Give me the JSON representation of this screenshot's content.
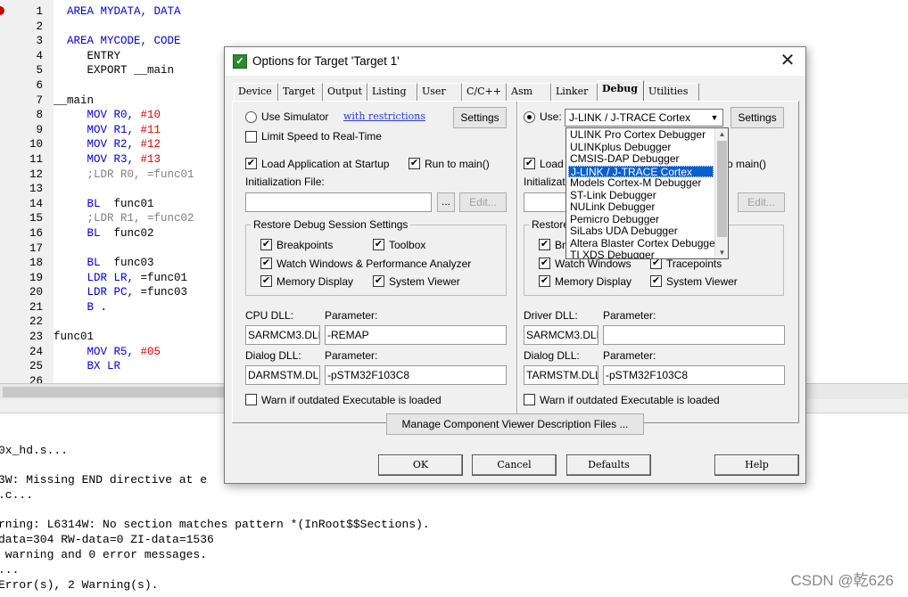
{
  "editor": {
    "lines": [
      {
        "n": "1",
        "parts": [
          {
            "t": "AREA MYDATA, DATA",
            "c": "kw",
            "indent": "  "
          }
        ]
      },
      {
        "n": "2",
        "parts": []
      },
      {
        "n": "3",
        "parts": [
          {
            "t": "AREA MYCODE, CODE",
            "c": "kw",
            "indent": "  "
          }
        ]
      },
      {
        "n": "4",
        "parts": [
          {
            "t": "ENTRY",
            "c": "plain",
            "indent": "     "
          }
        ]
      },
      {
        "n": "5",
        "parts": [
          {
            "t": "EXPORT __main",
            "c": "plain",
            "indent": "     "
          }
        ]
      },
      {
        "n": "6",
        "parts": []
      },
      {
        "n": "7",
        "parts": [
          {
            "t": "__main",
            "c": "plain",
            "indent": ""
          }
        ]
      },
      {
        "n": "8",
        "parts": [
          {
            "t": "MOV R0, ",
            "c": "kw",
            "indent": "     "
          },
          {
            "t": "#10",
            "c": "num"
          }
        ]
      },
      {
        "n": "9",
        "parts": [
          {
            "t": "MOV R1, ",
            "c": "kw",
            "indent": "     "
          },
          {
            "t": "#11",
            "c": "num"
          }
        ]
      },
      {
        "n": "10",
        "parts": [
          {
            "t": "MOV R2, ",
            "c": "kw",
            "indent": "     "
          },
          {
            "t": "#12",
            "c": "num"
          }
        ]
      },
      {
        "n": "11",
        "parts": [
          {
            "t": "MOV R3, ",
            "c": "kw",
            "indent": "     "
          },
          {
            "t": "#13",
            "c": "num"
          }
        ]
      },
      {
        "n": "12",
        "parts": [
          {
            "t": ";LDR R0, =func01",
            "c": "cmt",
            "indent": "     "
          }
        ]
      },
      {
        "n": "13",
        "parts": []
      },
      {
        "n": "14",
        "parts": [
          {
            "t": "BL  ",
            "c": "kw",
            "indent": "     "
          },
          {
            "t": "func01",
            "c": "plain"
          }
        ]
      },
      {
        "n": "15",
        "parts": [
          {
            "t": ";LDR R1, =func02",
            "c": "cmt",
            "indent": "     "
          }
        ]
      },
      {
        "n": "16",
        "parts": [
          {
            "t": "BL  ",
            "c": "kw",
            "indent": "     "
          },
          {
            "t": "func02",
            "c": "plain"
          }
        ]
      },
      {
        "n": "17",
        "parts": []
      },
      {
        "n": "18",
        "parts": [
          {
            "t": "BL  ",
            "c": "kw",
            "indent": "     "
          },
          {
            "t": "func03",
            "c": "plain"
          }
        ]
      },
      {
        "n": "19",
        "parts": [
          {
            "t": "LDR LR, ",
            "c": "kw",
            "indent": "     "
          },
          {
            "t": "=func01",
            "c": "plain"
          }
        ]
      },
      {
        "n": "20",
        "parts": [
          {
            "t": "LDR PC, ",
            "c": "kw",
            "indent": "     "
          },
          {
            "t": "=func03",
            "c": "plain"
          }
        ]
      },
      {
        "n": "21",
        "parts": [
          {
            "t": "B ",
            "c": "kw",
            "indent": "     "
          },
          {
            "t": ".",
            "c": "plain"
          }
        ]
      },
      {
        "n": "22",
        "parts": []
      },
      {
        "n": "23",
        "parts": [
          {
            "t": "func01",
            "c": "plain",
            "indent": ""
          }
        ]
      },
      {
        "n": "24",
        "parts": [
          {
            "t": "MOV R5, ",
            "c": "kw",
            "indent": "     "
          },
          {
            "t": "#05",
            "c": "num"
          }
        ]
      },
      {
        "n": "25",
        "parts": [
          {
            "t": "BX LR",
            "c": "kw",
            "indent": "     "
          }
        ]
      },
      {
        "n": "26",
        "parts": []
      }
    ]
  },
  "output": {
    "lines": [
      "0x_hd.s...",
      "",
      "3W: Missing END directive at e",
      ".c...",
      "",
      "rning: L6314W: No section matches pattern *(InRoot$$Sections).",
      "data=304 RW-data=0 ZI-data=1536",
      " warning and 0 error messages.",
      "...",
      "Error(s), 2 Warning(s)."
    ],
    "watermark": "CSDN @乾626"
  },
  "dialog": {
    "title": "Options for Target 'Target 1'",
    "close": "✕",
    "tabs": [
      "Device",
      "Target",
      "Output",
      "Listing",
      "User",
      "C/C++",
      "Asm",
      "Linker",
      "Debug",
      "Utilities"
    ],
    "left": {
      "use_simulator": "Use Simulator",
      "with_restrictions": "with restrictions",
      "settings": "Settings",
      "limit_speed": "Limit Speed to Real-Time",
      "load_app": "Load Application at Startup",
      "run_to_main": "Run to main()",
      "init_file_label": "Initialization File:",
      "browse": "...",
      "edit": "Edit...",
      "restore_title": "Restore Debug Session Settings",
      "breakpoints": "Breakpoints",
      "toolbox": "Toolbox",
      "watch_windows": "Watch Windows & Performance Analyzer",
      "memory_display": "Memory Display",
      "system_viewer": "System Viewer",
      "cpu_dll_label": "CPU DLL:",
      "cpu_param_label": "Parameter:",
      "cpu_dll": "SARMCM3.DLL",
      "cpu_param": "-REMAP",
      "dialog_dll_label": "Dialog DLL:",
      "dialog_param_label": "Parameter:",
      "dialog_dll": "DARMSTM.DLL",
      "dialog_param": "-pSTM32F103C8",
      "warn": "Warn if outdated Executable is loaded"
    },
    "right": {
      "use": "Use:",
      "combo_value": "J-LINK / J-TRACE Cortex",
      "settings": "Settings",
      "load": "Load",
      "run_tail": "o main()",
      "init_label": "Initializatio",
      "edit": "Edit...",
      "restore_label": "Restore",
      "br": "Br",
      "watch_windows": "Watch Windows",
      "tracepoints": "Tracepoints",
      "memory_display": "Memory Display",
      "system_viewer": "System Viewer",
      "driver_dll_label": "Driver DLL:",
      "driver_param_label": "Parameter:",
      "driver_dll": "SARMCM3.DLL",
      "driver_param": "",
      "dialog_dll_label": "Dialog DLL:",
      "dialog_param_label": "Parameter:",
      "dialog_dll": "TARMSTM.DLL",
      "dialog_param": "-pSTM32F103C8",
      "warn": "Warn if outdated Executable is loaded",
      "dropdown": [
        "ULINK Pro Cortex Debugger",
        "ULINKplus Debugger",
        "CMSIS-DAP Debugger",
        "J-LINK / J-TRACE Cortex",
        "Models Cortex-M Debugger",
        "ST-Link Debugger",
        "NULink Debugger",
        "Pemicro Debugger",
        "SiLabs UDA Debugger",
        "Altera Blaster Cortex Debugger",
        "TI XDS Debugger"
      ],
      "dropdown_selected": 3
    },
    "manage_btn": "Manage Component Viewer Description Files ...",
    "ok": "OK",
    "cancel": "Cancel",
    "defaults": "Defaults",
    "help": "Help",
    "check_mark": "✔"
  }
}
